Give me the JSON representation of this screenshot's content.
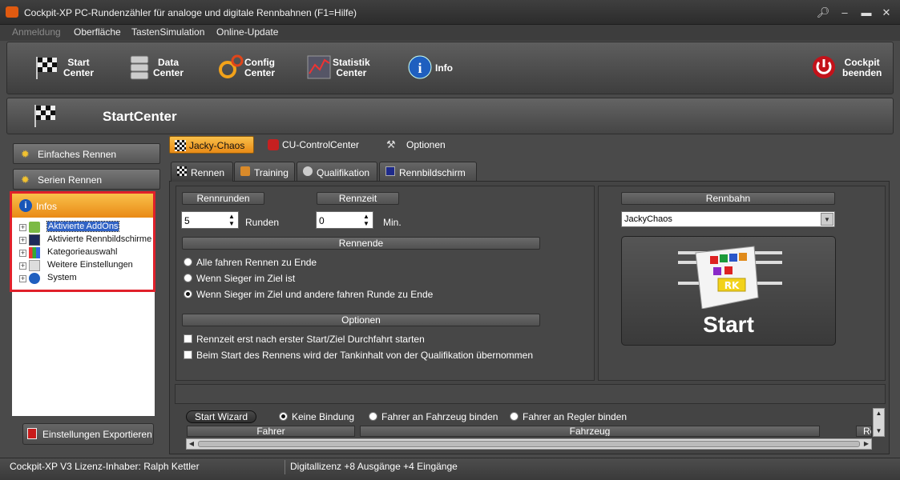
{
  "window": {
    "title": "Cockpit-XP PC-Rundenzähler für analoge und digitale Rennbahnen (F1=Hilfe)"
  },
  "menu": {
    "items": [
      "Anmeldung",
      "Oberfläche",
      "TastenSimulation",
      "Online-Update"
    ]
  },
  "toolbar": {
    "start": [
      "Start",
      "Center"
    ],
    "data": [
      "Data",
      "Center"
    ],
    "config": [
      "Config",
      "Center"
    ],
    "statistik": [
      "Statistik",
      "Center"
    ],
    "info": "Info",
    "quit": [
      "Cockpit",
      "beenden"
    ]
  },
  "header": {
    "title": "StartCenter"
  },
  "sidebar": {
    "einfaches": "Einfaches Rennen",
    "serien": "Serien Rennen",
    "infos": "Infos",
    "tree": [
      "Aktivierte AddOns",
      "Aktivierte Rennbildschirme",
      "Kategorieauswahl",
      "Weitere Einstellungen",
      "System"
    ],
    "export": "Einstellungen Exportieren"
  },
  "toptabs": {
    "jacky": "Jacky-Chaos",
    "cu": "CU-ControlCenter",
    "optionen": "Optionen"
  },
  "innertabs": {
    "rennen": "Rennen",
    "training": "Training",
    "quali": "Qualifikation",
    "bildschirm": "Rennbildschirm"
  },
  "rennen": {
    "rennrunden_label": "Rennrunden",
    "rennrunden_value": "5",
    "rennrunden_unit": "Runden",
    "rennzeit_label": "Rennzeit",
    "rennzeit_value": "0",
    "rennzeit_unit": "Min.",
    "rennende_label": "Rennende",
    "rennende_options": [
      "Alle fahren Rennen zu Ende",
      "Wenn Sieger im Ziel ist",
      "Wenn Sieger im Ziel und andere fahren Runde zu Ende"
    ],
    "optionen_label": "Optionen",
    "checks": [
      "Rennzeit erst nach erster Start/Ziel Durchfahrt starten",
      "Beim Start des Rennens wird der Tankinhalt von der Qualifikation übernommen"
    ]
  },
  "rennbahn": {
    "label": "Rennbahn",
    "selected": "JackyChaos",
    "start": "Start"
  },
  "wizard": {
    "button": "Start Wizard",
    "options": [
      "Keine Bindung",
      "Fahrer an Fahrzeug binden",
      "Fahrer an Regler binden"
    ],
    "col_fahrer": "Fahrer",
    "col_fahrzeug": "Fahrzeug",
    "col_r": "Re"
  },
  "status": {
    "left": "Cockpit-XP V3 Lizenz-Inhaber: Ralph Kettler",
    "right": "Digitallizenz  +8 Ausgänge +4 Eingänge"
  }
}
